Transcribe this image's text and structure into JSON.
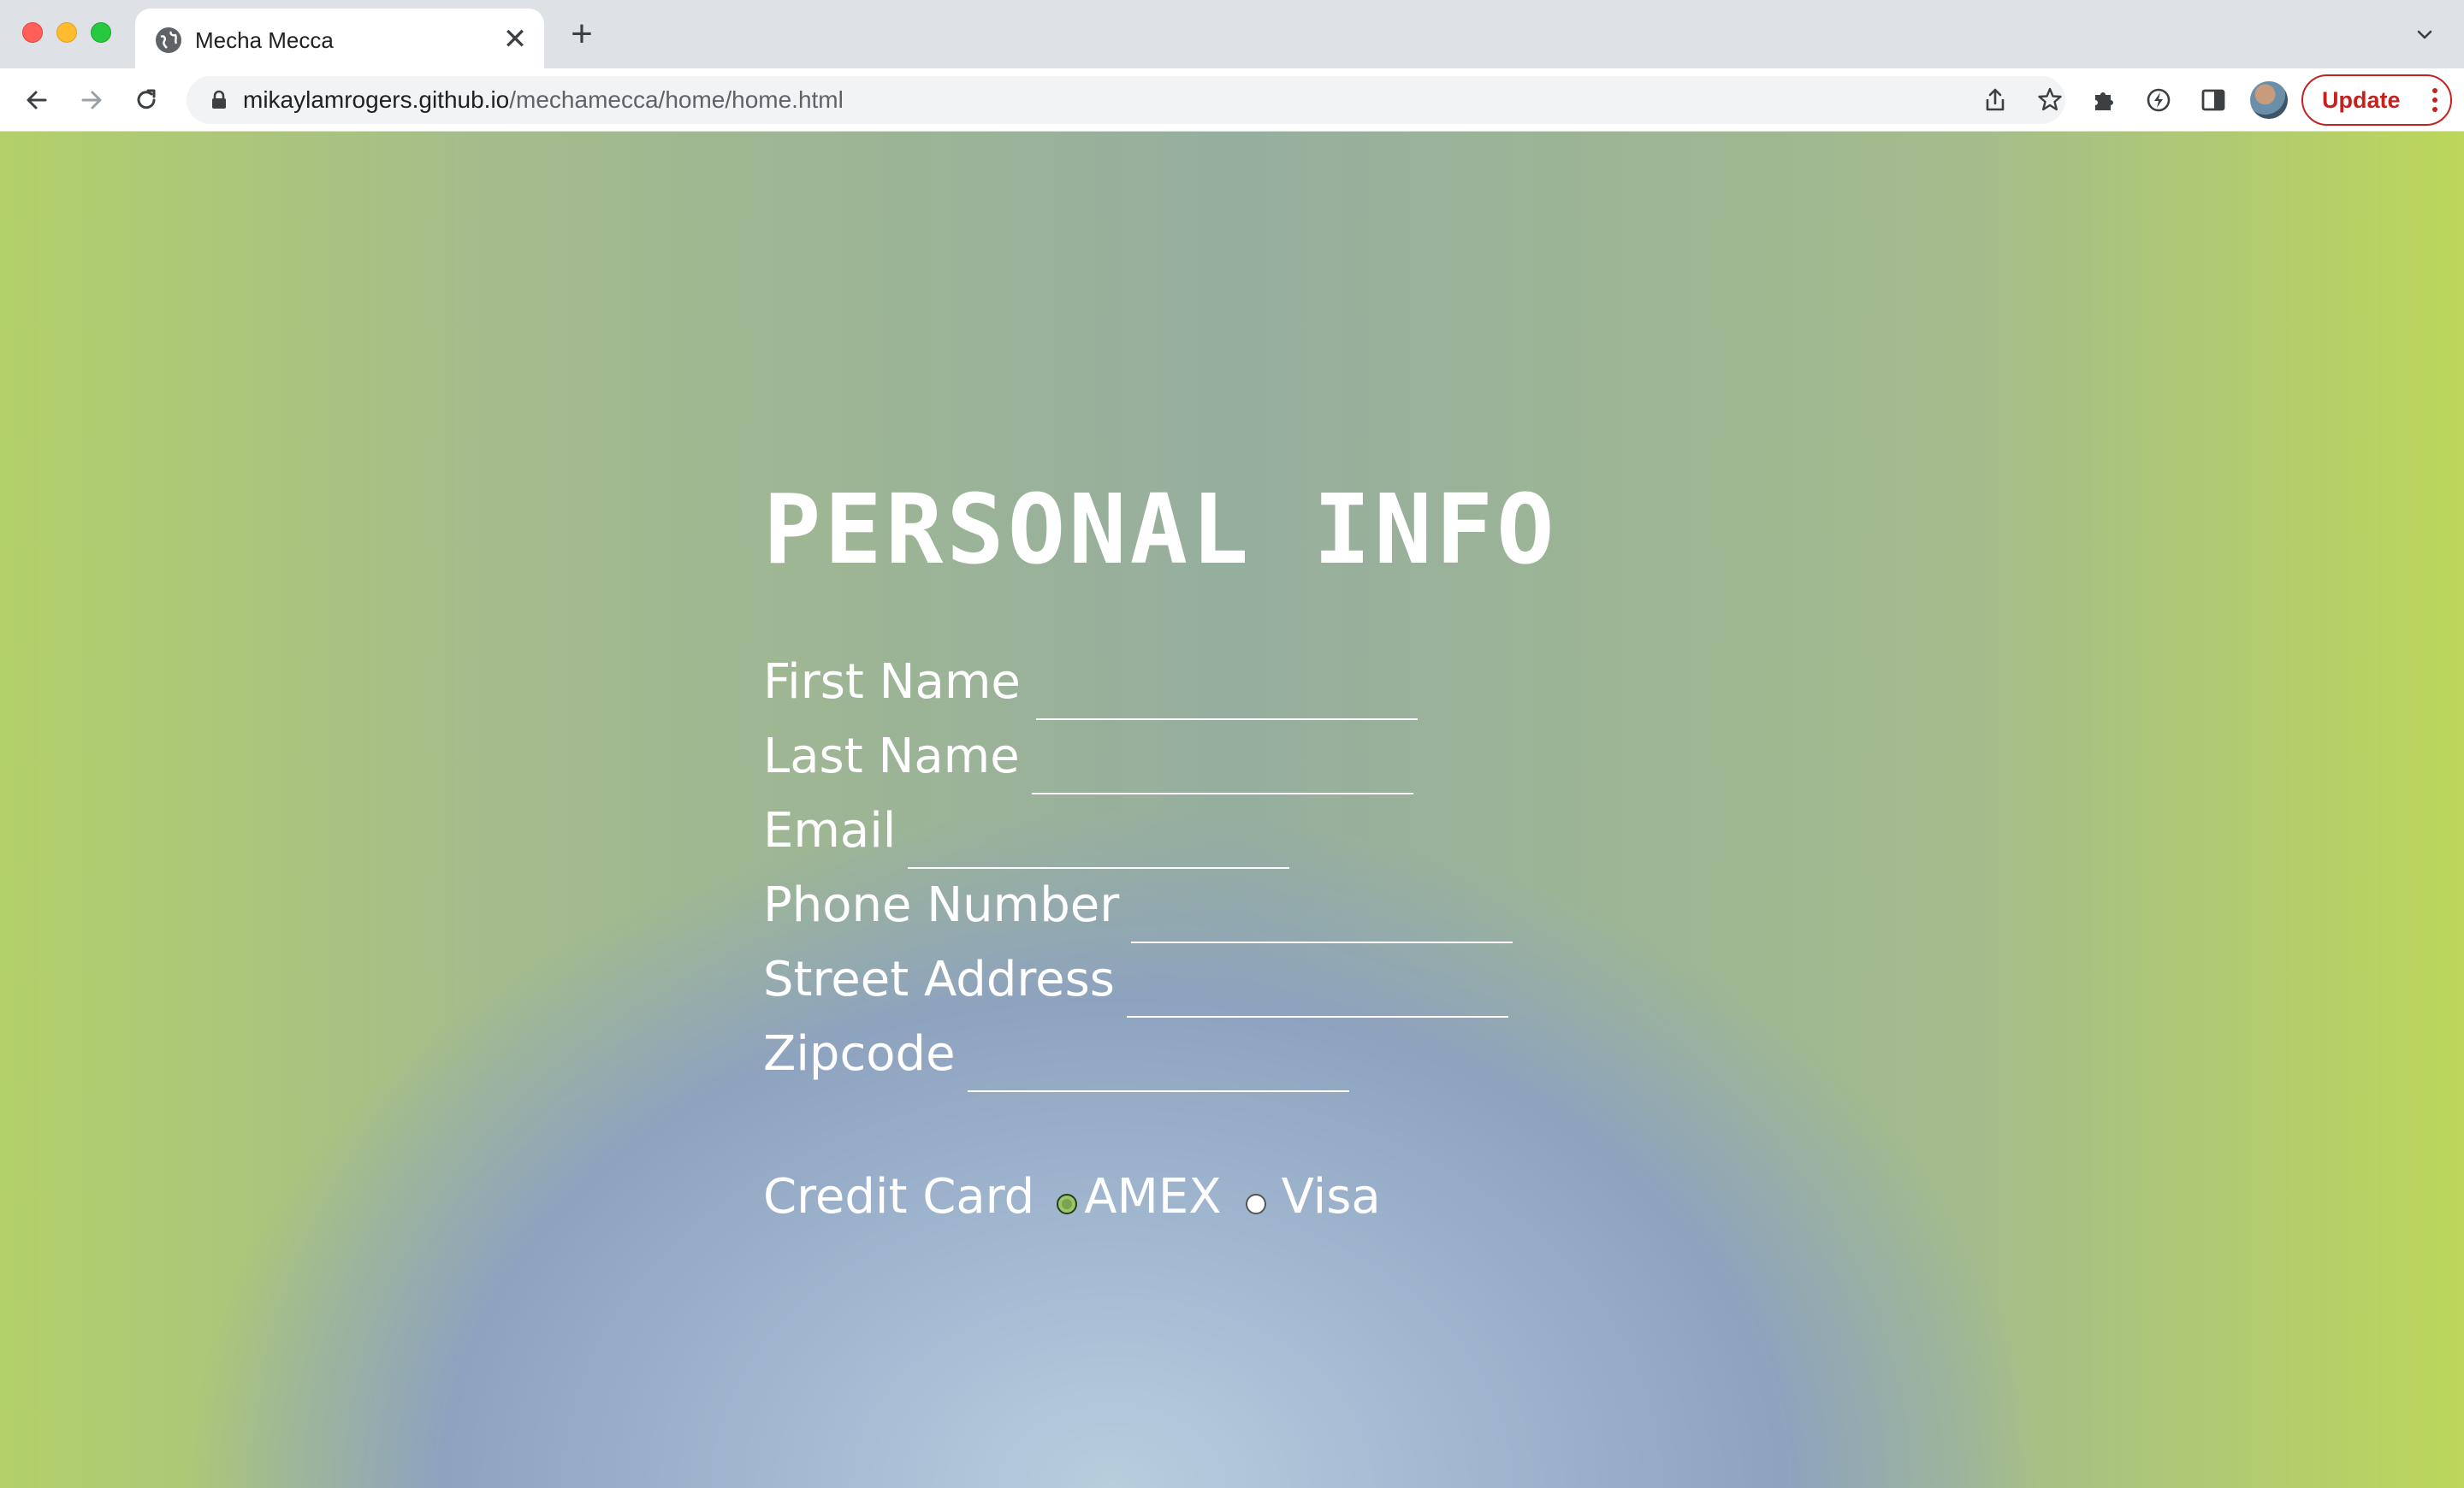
{
  "browser": {
    "tab_title": "Mecha Mecca",
    "url_host": "mikaylamrogers.github.io",
    "url_path": "/mechamecca/home/home.html",
    "update_label": "Update",
    "tab_close_glyph": "✕",
    "new_tab_glyph": "+"
  },
  "page": {
    "heading": "PERSONAL INFO",
    "fields": [
      {
        "label": "First Name",
        "value": ""
      },
      {
        "label": "Last Name",
        "value": ""
      },
      {
        "label": "Email",
        "value": ""
      },
      {
        "label": "Phone Number",
        "value": ""
      },
      {
        "label": "Street Address",
        "value": ""
      },
      {
        "label": "Zipcode",
        "value": ""
      }
    ],
    "credit_card": {
      "label": "Credit Card",
      "options": [
        {
          "label": "AMEX",
          "selected": true
        },
        {
          "label": "Visa",
          "selected": false
        }
      ]
    }
  },
  "colors": {
    "accent_update": "#c5221f",
    "text_on_page": "#ffffff",
    "radio_selected": "#7aa34f"
  }
}
